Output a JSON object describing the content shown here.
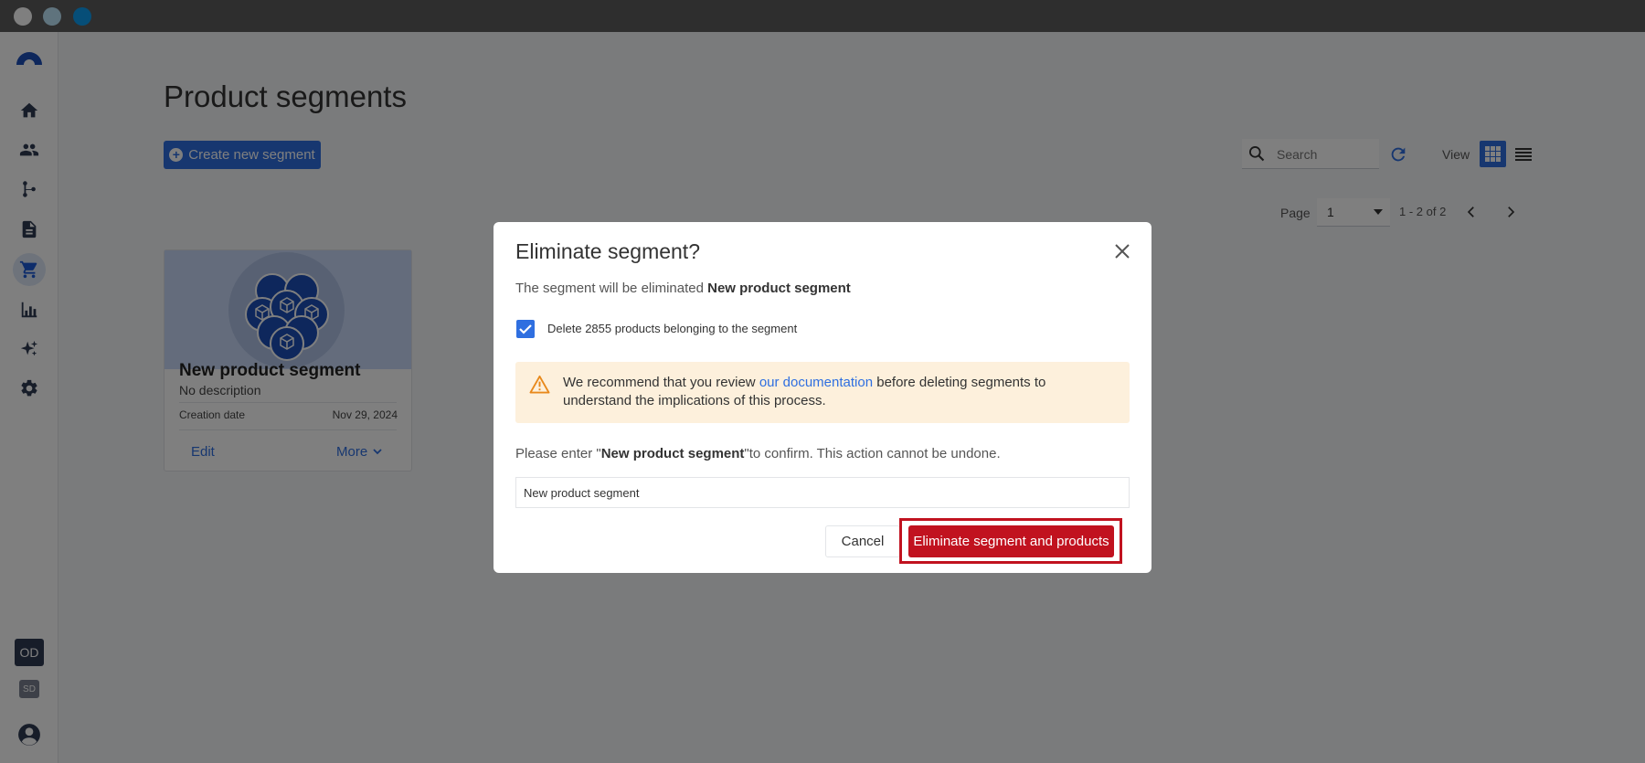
{
  "page": {
    "title": "Product segments",
    "create_button": "Create new segment",
    "search_placeholder": "Search",
    "view_label": "View",
    "page_label": "Page",
    "current_page": "1",
    "range": "1 - 2 of 2"
  },
  "sidebar": {
    "items": [
      "home-icon",
      "people-icon",
      "flow-icon",
      "document-icon",
      "cart-icon",
      "chart-icon",
      "sparkle-icon",
      "settings-icon"
    ],
    "active_item": "cart-icon",
    "workspace_badge": "OD",
    "secondary_badge": "SD"
  },
  "card": {
    "title": "New product segment",
    "description": "No description",
    "date_label": "Creation date",
    "date_value": "Nov 29, 2024",
    "edit_label": "Edit",
    "more_label": "More"
  },
  "modal": {
    "title": "Eliminate segment?",
    "message_prefix": "The segment will be eliminated ",
    "segment_name": "New product segment",
    "checkbox_label": "Delete 2855 products belonging to the segment",
    "checkbox_checked": true,
    "warning_prefix": "We recommend that you review ",
    "warning_link": "our documentation",
    "warning_suffix": " before deleting segments to understand the implications of this process.",
    "confirm_prefix": "Please enter \"",
    "confirm_suffix": "\"to confirm. This action cannot be undone.",
    "confirm_input_value": "New product segment",
    "cancel_label": "Cancel",
    "eliminate_label": "Eliminate segment and products"
  },
  "colors": {
    "primary": "#2f6fe0",
    "danger": "#c1121f",
    "warning_bg": "#fdf0dc",
    "warning_icon": "#e8891c"
  }
}
